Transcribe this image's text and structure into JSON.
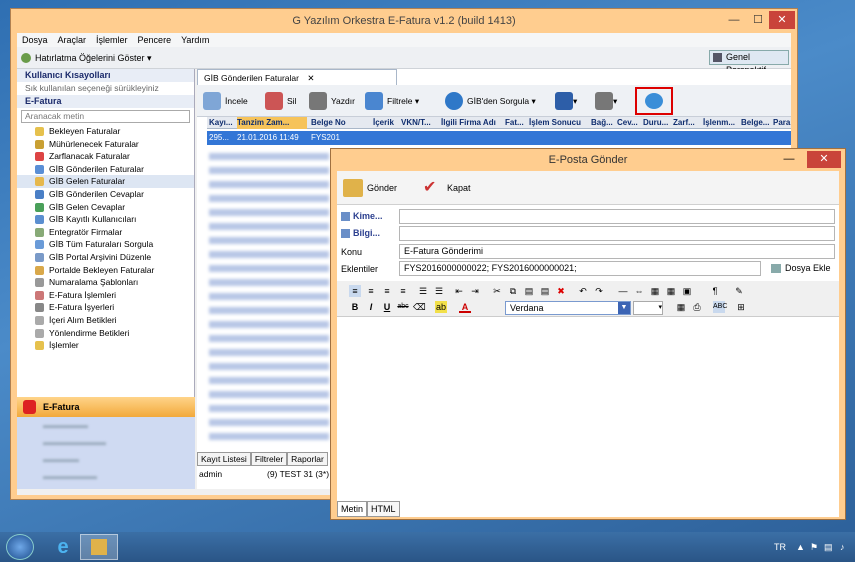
{
  "app": {
    "title": "G Yazılım Orkestra E-Fatura v1.2 (build 1413)",
    "min": "—",
    "max": "☐",
    "close": "✕"
  },
  "menu": [
    "Dosya",
    "Araçlar",
    "İşlemler",
    "Pencere",
    "Yardım"
  ],
  "toolbar": {
    "history_label": "Hatırlatma Öğelerini Göster",
    "perspective_label": "Genel Perspektif"
  },
  "sidebar": {
    "header": "Kullanıcı Kısayolları",
    "hint": "Sık kullanılan seçeneği sürükleyiniz",
    "section": "E-Fatura",
    "search_placeholder": "Aranacak metin",
    "items": [
      "Bekleyen Faturalar",
      "Mühürlenecek Faturalar",
      "Zarflanacak Faturalar",
      "GİB Gönderilen Faturalar",
      "GİB Gelen Faturalar",
      "GİB Gönderilen Cevaplar",
      "GİB Gelen Cevaplar",
      "GİB Kayıtlı Kullanıcıları",
      "Entegratör Firmalar",
      "GİB Tüm Faturaları Sorgula",
      "GİB Portal Arşivini Düzenle",
      "Portalde Bekleyen Faturalar",
      "Numaralama Şablonları",
      "E-Fatura İşlemleri",
      "E-Fatura İşyerleri",
      "İçeri Alım Betikleri",
      "Yönlendirme Betikleri",
      "İşlemler"
    ],
    "nav_active": "E-Fatura"
  },
  "main": {
    "tab": "GİB Gönderilen Faturalar",
    "buttons": {
      "inspect": "İncele",
      "delete": "Sil",
      "print": "Yazdır",
      "filter": "Filtrele",
      "query": "GİB'den Sorgula"
    },
    "columns": [
      "Kayı...",
      "Tanzim Zam...",
      "Belge No",
      "İçerik",
      "VKN/T...",
      "İlgili Firma Adı",
      "Fat...",
      "İşlem Sonucu",
      "Bağ...",
      "Cev...",
      "Duru...",
      "Zarf...",
      "İşlenm...",
      "Belge...",
      "Para"
    ],
    "row": {
      "c1": "295...",
      "c2": "21.01.2016 11:49",
      "c3": "FYS201"
    },
    "bottom_tabs": [
      "Kayıt Listesi",
      "Filtreler",
      "Raporlar"
    ],
    "status": {
      "user": "admin",
      "info": "(9) TEST 31  (3*)  01"
    }
  },
  "email": {
    "title": "E-Posta Gönder",
    "send": "Gönder",
    "close": "Kapat",
    "to_label": "Kime...",
    "cc_label": "Bilgi...",
    "subject_label": "Konu",
    "subject": "E-Fatura Gönderimi",
    "attach_label": "Eklentiler",
    "attachments": "FYS2016000000022;  FYS2016000000021;",
    "add_file": "Dosya Ekle",
    "font": "Verdana",
    "tabs": [
      "Metin",
      "HTML"
    ]
  },
  "taskbar": {
    "lang": "TR"
  }
}
